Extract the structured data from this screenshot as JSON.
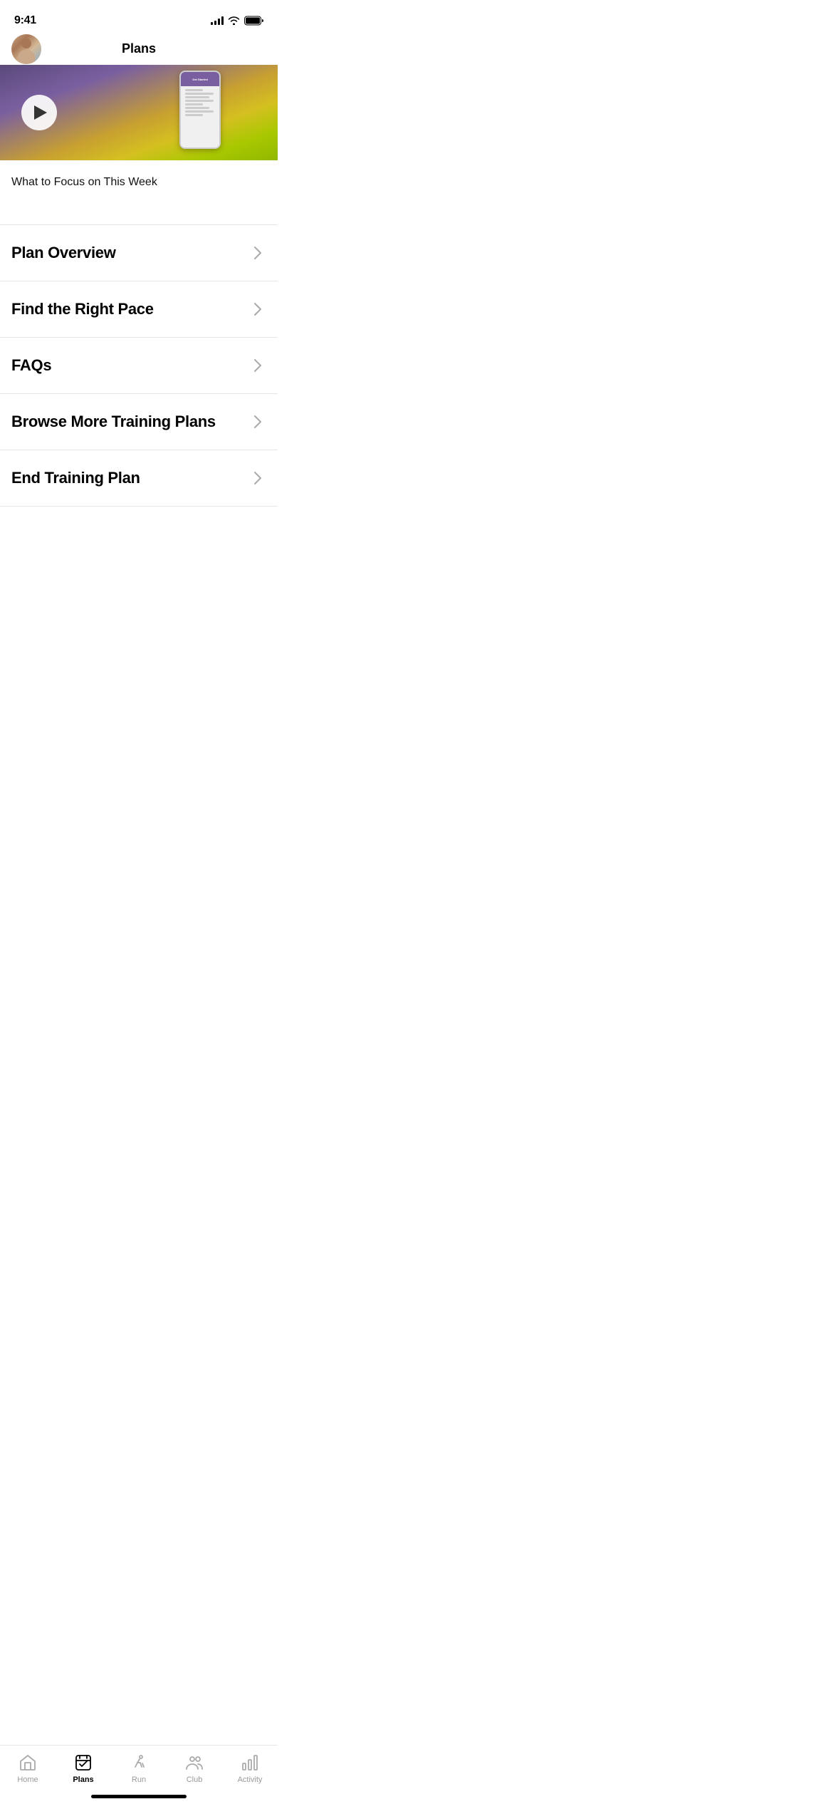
{
  "status": {
    "time": "9:41",
    "time_with_icon": "9:41 ›"
  },
  "header": {
    "title": "Plans"
  },
  "hero": {
    "play_button_label": "Play"
  },
  "content": {
    "section_label": "What to Focus on This Week",
    "menu_items": [
      {
        "id": "plan-overview",
        "label": "Plan Overview"
      },
      {
        "id": "find-right-pace",
        "label": "Find the Right Pace"
      },
      {
        "id": "faqs",
        "label": "FAQs"
      },
      {
        "id": "browse-more",
        "label": "Browse More Training Plans"
      },
      {
        "id": "end-plan",
        "label": "End Training Plan"
      }
    ]
  },
  "bottom_nav": {
    "items": [
      {
        "id": "home",
        "label": "Home",
        "active": false
      },
      {
        "id": "plans",
        "label": "Plans",
        "active": true
      },
      {
        "id": "run",
        "label": "Run",
        "active": false
      },
      {
        "id": "club",
        "label": "Club",
        "active": false
      },
      {
        "id": "activity",
        "label": "Activity",
        "active": false
      }
    ]
  }
}
